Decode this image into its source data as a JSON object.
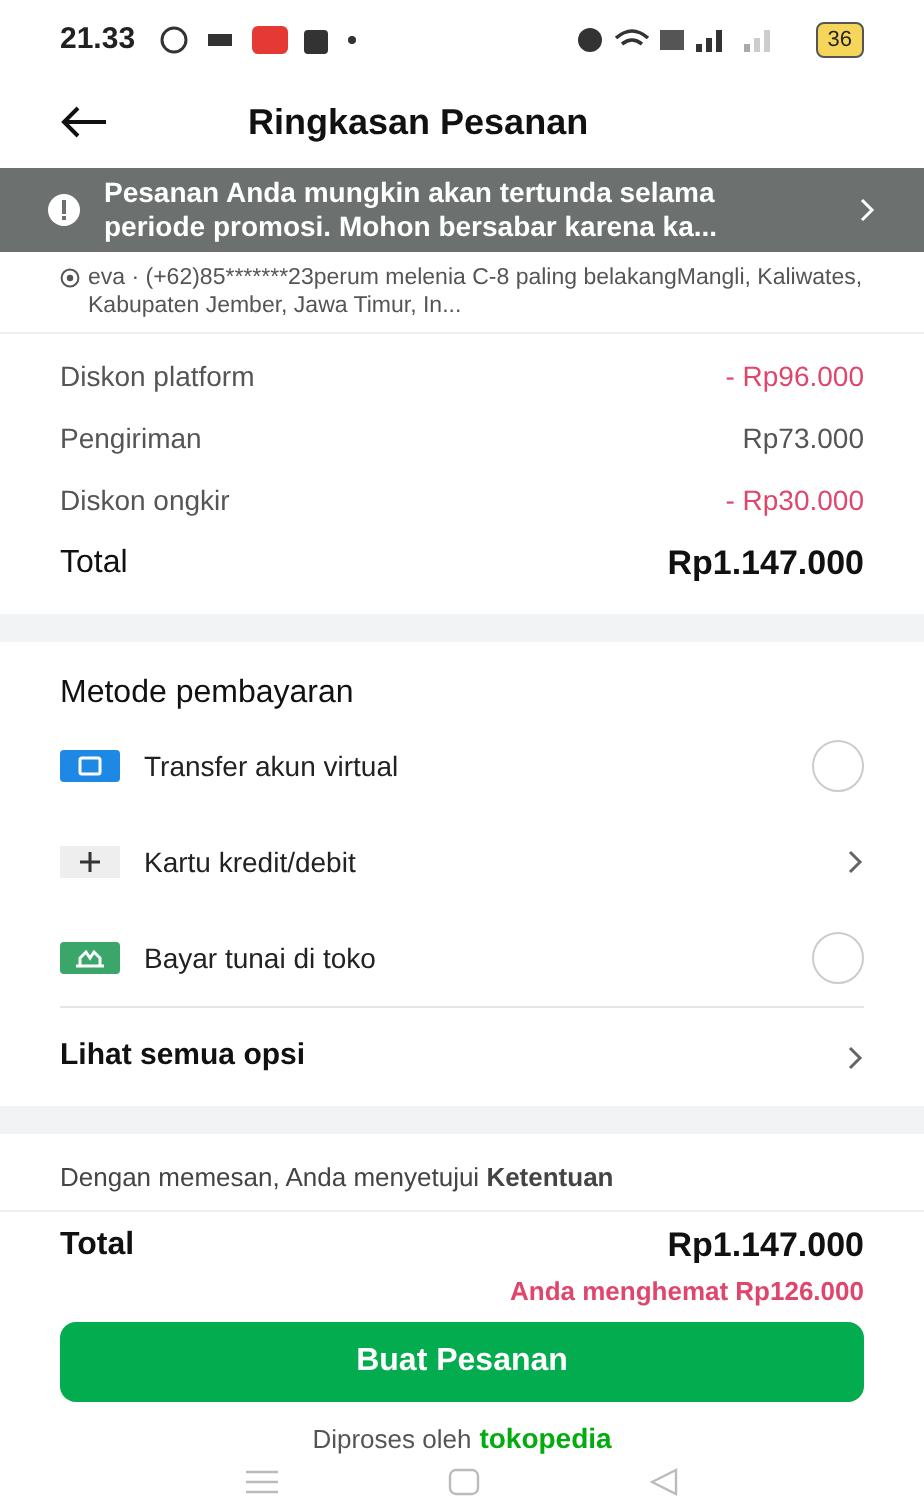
{
  "status_bar": {
    "time": "21.33",
    "battery": "36"
  },
  "header": {
    "title": "Ringkasan Pesanan"
  },
  "banner": {
    "text": "Pesanan Anda mungkin akan tertunda selama periode promosi. Mohon bersabar karena ka..."
  },
  "address": {
    "text": "eva · (+62)85*******23perum  melenia C-8 paling belakangMangli, Kaliwates, Kabupaten Jember, Jawa Timur, In..."
  },
  "summary": [
    {
      "label": "Diskon platform",
      "value": "- Rp96.000",
      "kind": "discount"
    },
    {
      "label": "Pengiriman",
      "value": "Rp73.000",
      "kind": "normal"
    },
    {
      "label": "Diskon ongkir",
      "value": "- Rp30.000",
      "kind": "discount"
    },
    {
      "label": "Total",
      "value": "Rp1.147.000",
      "kind": "total"
    }
  ],
  "payment": {
    "title": "Metode pembayaran",
    "methods": [
      {
        "label": "Transfer akun virtual",
        "kind": "radio",
        "selected": false
      },
      {
        "label": "Kartu kredit/debit",
        "kind": "link"
      },
      {
        "label": "Bayar tunai di toko",
        "kind": "radio",
        "selected": false
      }
    ],
    "see_all": "Lihat semua opsi"
  },
  "consent": "Dengan memesan, Anda menyetujui **Ketentuan**",
  "footer": {
    "total_label": "Total",
    "total_value": "Rp1.147.000",
    "savings": "Anda menghemat Rp126.000",
    "button": "Buat Pesanan",
    "processed_by": "Diproses oleh",
    "brand": "tokopedia"
  }
}
